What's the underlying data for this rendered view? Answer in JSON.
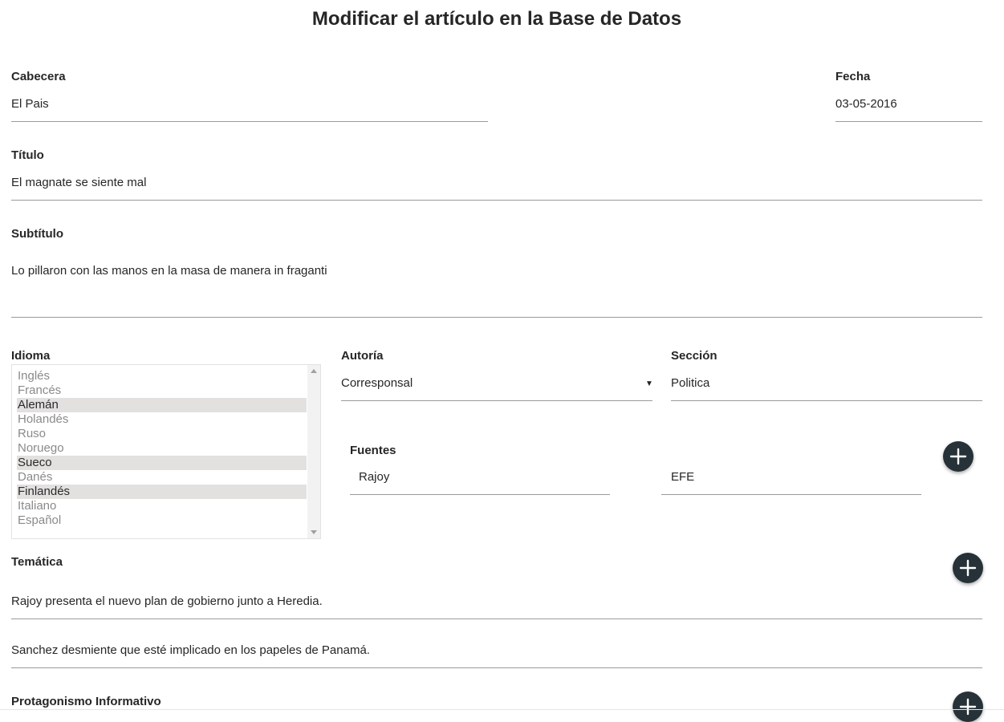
{
  "page": {
    "title": "Modificar el artículo en la Base de Datos"
  },
  "cabecera": {
    "label": "Cabecera",
    "value": "El Pais"
  },
  "fecha": {
    "label": "Fecha",
    "value": "03-05-2016"
  },
  "titulo": {
    "label": "Título",
    "value": "El magnate se siente mal"
  },
  "subtitulo": {
    "label": "Subtítulo",
    "value": "Lo pillaron con las manos en la masa de manera in fraganti"
  },
  "idioma": {
    "label": "Idioma",
    "options": [
      {
        "label": "Inglés",
        "selected": false
      },
      {
        "label": "Francés",
        "selected": false
      },
      {
        "label": "Alemán",
        "selected": true
      },
      {
        "label": "Holandés",
        "selected": false
      },
      {
        "label": "Ruso",
        "selected": false
      },
      {
        "label": "Noruego",
        "selected": false
      },
      {
        "label": "Sueco",
        "selected": true
      },
      {
        "label": "Danés",
        "selected": false
      },
      {
        "label": "Finlandés",
        "selected": true
      },
      {
        "label": "Italiano",
        "selected": false
      },
      {
        "label": "Español",
        "selected": false
      }
    ]
  },
  "autoria": {
    "label": "Autoría",
    "value": "Corresponsal",
    "caret": "▼"
  },
  "seccion": {
    "label": "Sección",
    "value": "Politica"
  },
  "fuentes": {
    "label": "Fuentes",
    "values": [
      "Rajoy",
      "EFE"
    ]
  },
  "tematica": {
    "label": "Temática",
    "values": [
      "Rajoy presenta el nuevo plan de gobierno junto a Heredia.",
      "Sanchez desmiente que esté implicado en los papeles de Panamá."
    ]
  },
  "protagonismo": {
    "label": "Protagonismo Informativo"
  },
  "colors": {
    "fab": "#263238",
    "selected_option": "#e3e1e0",
    "underline": "#9a9a9a"
  },
  "icons": {
    "add": "plus-icon"
  }
}
